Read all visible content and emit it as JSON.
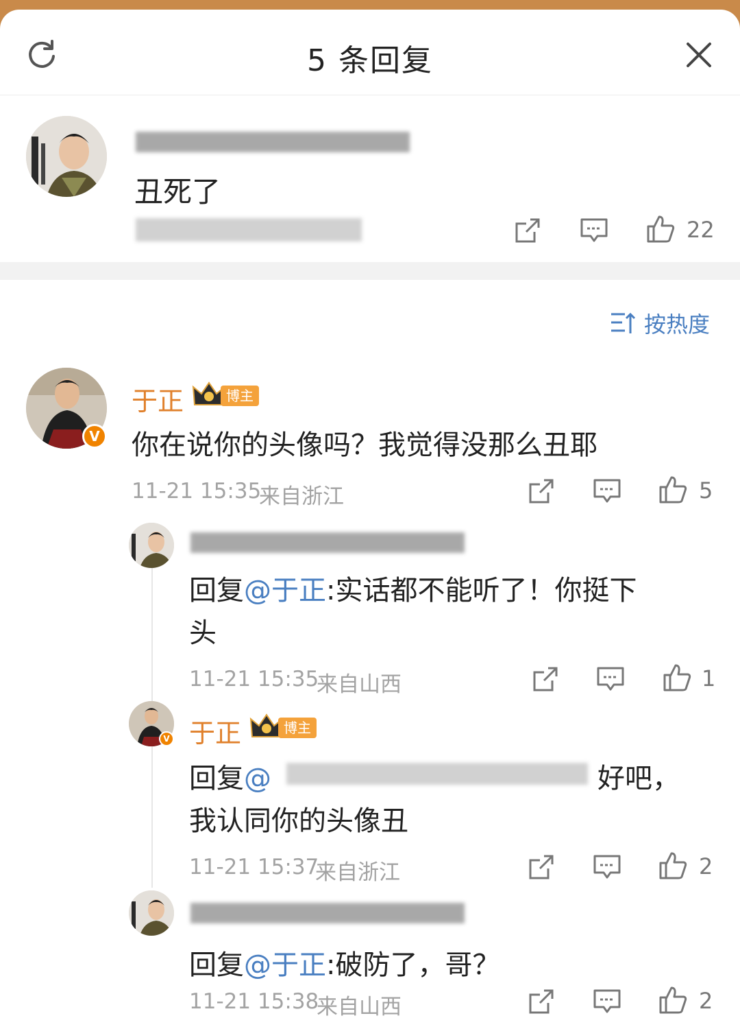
{
  "header": {
    "title": "5 条回复",
    "refresh_icon": "refresh-icon",
    "close_icon": "close-icon"
  },
  "root_comment": {
    "text": "丑死了",
    "likes": "22"
  },
  "sort": {
    "label": "按热度",
    "icon": "sort-icon"
  },
  "replies": [
    {
      "name": "于正",
      "badge": "博主",
      "text": "你在说你的头像吗？我觉得没那么丑耶",
      "time": "11-21 15:35",
      "location": "来自浙江",
      "likes": "5"
    },
    {
      "prefix": "回复",
      "mention": "@于正",
      "text_line1": ":实话都不能听了！你挺下",
      "text_line2": "头",
      "time": "11-21 15:35",
      "location": "来自山西",
      "likes": "1"
    },
    {
      "name": "于正",
      "badge": "博主",
      "prefix": "回复",
      "mention_at": "@",
      "text_tail": "好吧，",
      "text_line2": "我认同你的头像丑",
      "time": "11-21 15:37",
      "location": "来自浙江",
      "likes": "2"
    },
    {
      "prefix": "回复",
      "mention": "@于正",
      "text": ":破防了，哥？",
      "time": "11-21 15:38",
      "location": "来自山西",
      "likes": "2"
    }
  ],
  "colors": {
    "accent_name": "#e0802b",
    "mention": "#4a7fc1",
    "badge": "#f4a23b",
    "verified": "#f08300"
  }
}
